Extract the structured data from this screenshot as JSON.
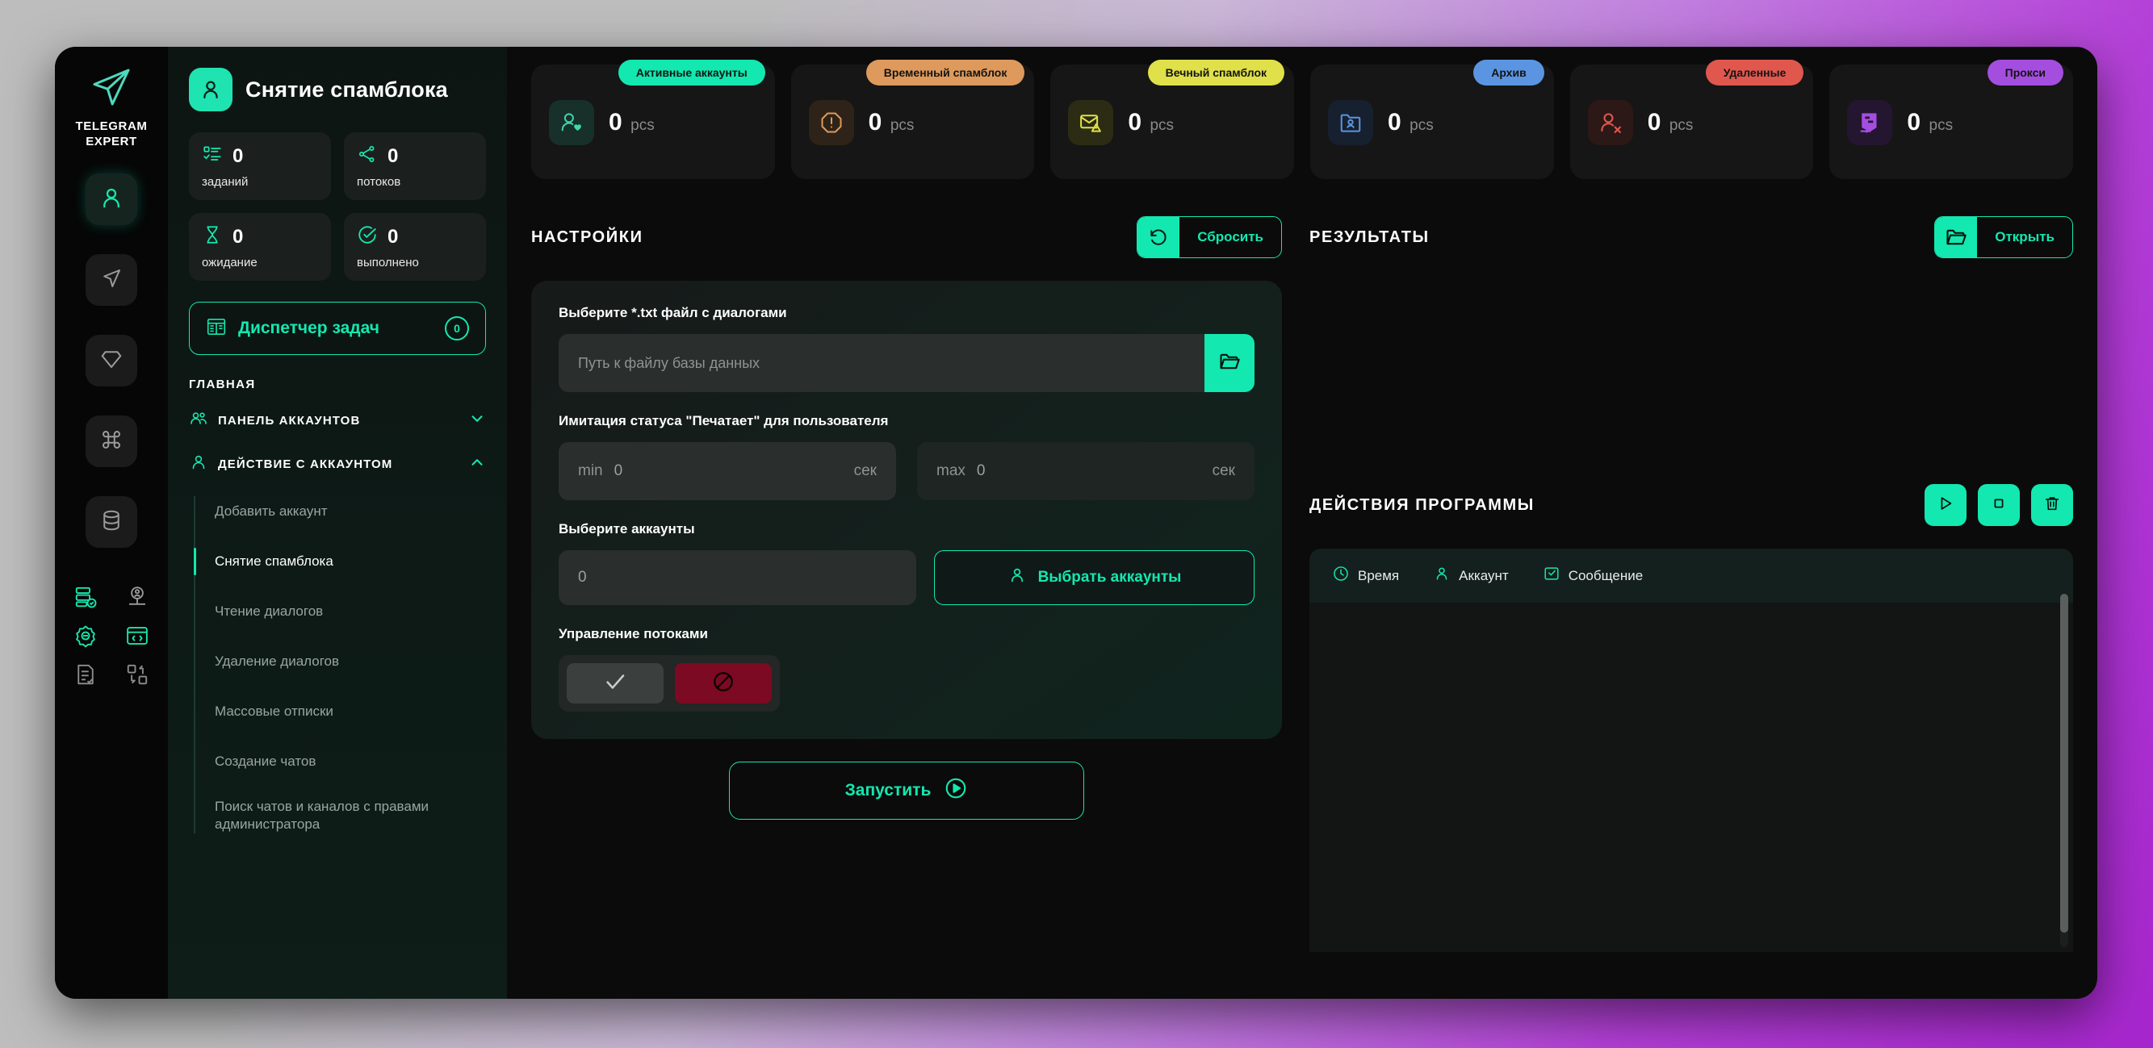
{
  "brand": {
    "line1": "TELEGRAM",
    "line2": "EXPERT",
    "logo_icon": "paper-plane-icon"
  },
  "rail": {
    "main_items": [
      {
        "icon": "user-icon",
        "active": true
      },
      {
        "icon": "paper-plane-icon",
        "active": false
      },
      {
        "icon": "diamond-icon",
        "active": false
      },
      {
        "icon": "command-icon",
        "active": false
      },
      {
        "icon": "database-icon",
        "active": false
      }
    ],
    "mini_items": [
      {
        "icon": "server-check-icon",
        "accent": true
      },
      {
        "icon": "user-network-icon",
        "accent": false
      },
      {
        "icon": "gear-settings-icon",
        "accent": true
      },
      {
        "icon": "code-window-icon",
        "accent": true
      },
      {
        "icon": "document-check-icon",
        "accent": false
      },
      {
        "icon": "transfer-icon",
        "accent": false
      }
    ]
  },
  "panel": {
    "title": "Снятие спамблока",
    "title_icon": "user-icon",
    "stats": [
      {
        "value": "0",
        "label": "заданий",
        "icon": "task-list-icon"
      },
      {
        "value": "0",
        "label": "потоков",
        "icon": "share-nodes-icon"
      },
      {
        "value": "0",
        "label": "ожидание",
        "icon": "hourglass-icon"
      },
      {
        "value": "0",
        "label": "выполнено",
        "icon": "check-circle-icon"
      }
    ],
    "dispatcher": {
      "label": "Диспетчер задач",
      "badge": "0",
      "icon": "dashboard-icon"
    },
    "nav_section_title": "ГЛАВНАЯ",
    "groups": [
      {
        "label": "ПАНЕЛЬ АККАУНТОВ",
        "icon": "users-icon",
        "chevron": "chevron-down-icon",
        "expanded": false
      },
      {
        "label": "ДЕЙСТВИЕ С АККАУНТОМ",
        "icon": "user-icon",
        "chevron": "chevron-up-icon",
        "expanded": true
      }
    ],
    "nav_items": [
      {
        "label": "Добавить аккаунт",
        "active": false
      },
      {
        "label": "Снятие спамблока",
        "active": true
      },
      {
        "label": "Чтение диалогов",
        "active": false
      },
      {
        "label": "Удаление диалогов",
        "active": false
      },
      {
        "label": "Массовые отписки",
        "active": false
      },
      {
        "label": "Создание чатов",
        "active": false
      },
      {
        "label": "Поиск чатов и каналов с правами администратора",
        "active": false
      }
    ]
  },
  "top_cards": [
    {
      "badge": "Активные аккаунты",
      "badge_color": "#12e8b0",
      "value": "0",
      "unit": "pcs",
      "icon": "user-heart-icon",
      "icon_color": "#3fd8a8",
      "icon_bg": "#18302a"
    },
    {
      "badge": "Временный спамблок",
      "badge_color": "#dd9a5c",
      "value": "0",
      "unit": "pcs",
      "icon": "alert-octagon-icon",
      "icon_color": "#dd9a5c",
      "icon_bg": "#2e2318"
    },
    {
      "badge": "Вечный спамблок",
      "badge_color": "#e0e04a",
      "value": "0",
      "unit": "pcs",
      "icon": "mail-warning-icon",
      "icon_color": "#e0e04a",
      "icon_bg": "#2c2c14"
    },
    {
      "badge": "Архив",
      "badge_color": "#5b95e2",
      "value": "0",
      "unit": "pcs",
      "icon": "folder-user-icon",
      "icon_color": "#5b95e2",
      "icon_bg": "#17202e"
    },
    {
      "badge": "Удаленные",
      "badge_color": "#e0574e",
      "value": "0",
      "unit": "pcs",
      "icon": "user-x-icon",
      "icon_color": "#e0574e",
      "icon_bg": "#2c1817"
    },
    {
      "badge": "Прокси",
      "badge_color": "#a council",
      "value": "0",
      "unit": "pcs",
      "icon": "proxy-server-icon",
      "icon_color": "#a44ee0",
      "icon_bg": "#241630"
    }
  ],
  "settings": {
    "title": "НАСТРОЙКИ",
    "reset_button": {
      "label": "Сбросить",
      "icon": "undo-icon"
    },
    "file_field": {
      "label": "Выберите *.txt файл с диалогами",
      "placeholder": "Путь к файлу базы данных",
      "value": "",
      "browse_icon": "folder-open-icon"
    },
    "typing_field": {
      "label": "Имитация статуса \"Печатает\" для пользователя",
      "min_prefix": "min",
      "min_value": "0",
      "min_suffix": "сек",
      "max_prefix": "max",
      "max_value": "0",
      "max_suffix": "сек"
    },
    "accounts_field": {
      "label": "Выберите аккаунты",
      "value": "0",
      "button_label": "Выбрать аккаунты",
      "button_icon": "user-icon"
    },
    "threads_field": {
      "label": "Управление потоками",
      "ok_icon": "check-icon",
      "stop_icon": "ban-icon"
    },
    "run_button": {
      "label": "Запустить",
      "icon": "play-circle-icon"
    }
  },
  "results": {
    "title": "РЕЗУЛЬТАТЫ",
    "open_button": {
      "label": "Открыть",
      "icon": "folder-open-icon"
    }
  },
  "program_actions": {
    "title": "ДЕЙСТВИЯ ПРОГРАММЫ",
    "buttons": [
      {
        "icon": "play-icon"
      },
      {
        "icon": "stop-icon"
      },
      {
        "icon": "trash-icon"
      }
    ],
    "columns": [
      {
        "label": "Время",
        "icon": "clock-icon"
      },
      {
        "label": "Аккаунт",
        "icon": "user-icon"
      },
      {
        "label": "Сообщение",
        "icon": "message-check-icon"
      }
    ],
    "rows": []
  },
  "colors": {
    "accent": "#13e8b0",
    "panel_bg": "#0d1a16",
    "window_bg": "#0b0b0b"
  }
}
